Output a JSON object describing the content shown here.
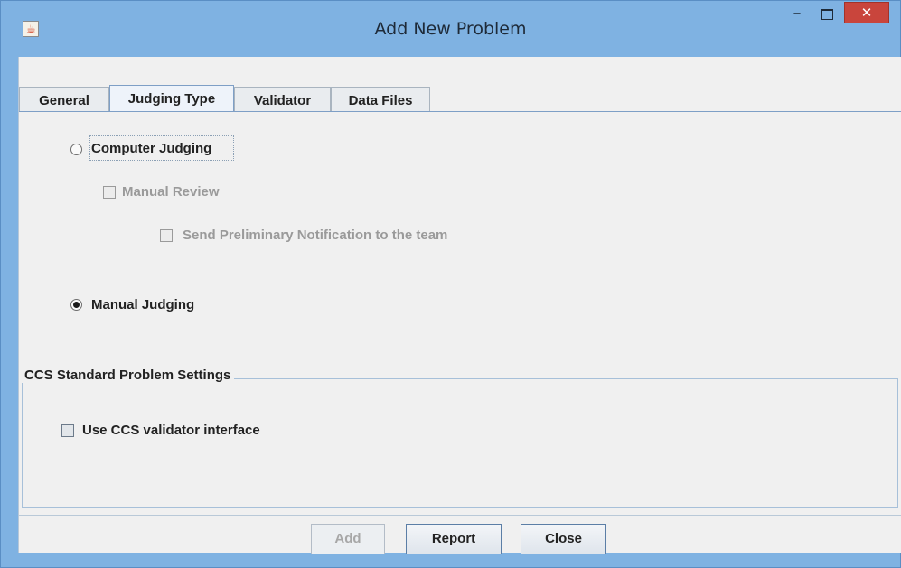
{
  "window": {
    "title": "Add New Problem",
    "close_glyph": "✕",
    "minimize_glyph": "–"
  },
  "tabs": [
    {
      "label": "General"
    },
    {
      "label": "Judging Type"
    },
    {
      "label": "Validator"
    },
    {
      "label": "Data Files"
    }
  ],
  "active_tab": "Judging Type",
  "judging": {
    "computer_label": "Computer Judging",
    "manual_review_label": "Manual Review",
    "send_notification_label": "Send Preliminary Notification to the team",
    "manual_label": "Manual Judging",
    "selected": "Manual Judging"
  },
  "ccs": {
    "group_title": "CCS Standard Problem Settings",
    "validator_label": "Use CCS validator interface",
    "validator_checked": false
  },
  "buttons": {
    "add": "Add",
    "report": "Report",
    "close": "Close"
  }
}
